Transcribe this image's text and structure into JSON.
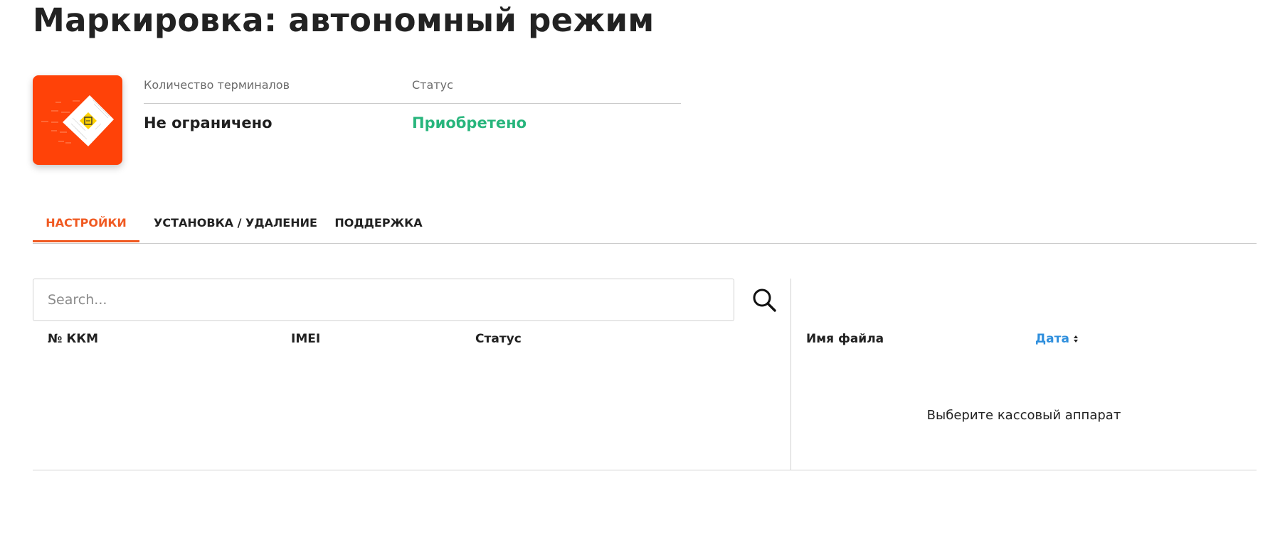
{
  "page": {
    "title": "Маркировка: автономный режим"
  },
  "info": {
    "terminals_label": "Количество терминалов",
    "terminals_value": "Не ограничено",
    "status_label": "Статус",
    "status_value": "Приобретено"
  },
  "tabs": [
    {
      "label": "НАСТРОЙКИ",
      "active": true
    },
    {
      "label": "УСТАНОВКА / УДАЛЕНИЕ",
      "active": false
    },
    {
      "label": "ПОДДЕРЖКА",
      "active": false
    }
  ],
  "search": {
    "placeholder": "Search...",
    "value": ""
  },
  "kkm_table": {
    "columns": [
      "№ ККМ",
      "IMEI",
      "Статус"
    ],
    "rows": []
  },
  "files_table": {
    "columns": [
      "Имя файла",
      "Дата"
    ],
    "sort_column": "Дата",
    "empty_message": "Выберите кассовый аппарат"
  },
  "colors": {
    "accent": "#f05a22",
    "logo_bg": "#ff4208",
    "status_green": "#27b57c",
    "link_blue": "#2f8fdd"
  },
  "icons": {
    "search": "search-icon",
    "sort": "sort-icon",
    "logo": "app-logo"
  }
}
